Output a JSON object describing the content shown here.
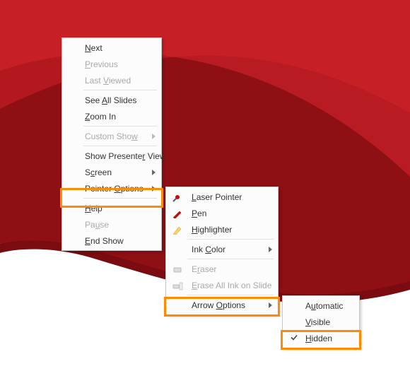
{
  "menu1": {
    "next": "Next",
    "previous": "Previous",
    "last_viewed": "Last Viewed",
    "see_all_slides": "See All Slides",
    "zoom_in": "Zoom In",
    "custom_show": "Custom Show",
    "show_presenter_view": "Show Presenter View",
    "screen": "Screen",
    "pointer_options": "Pointer Options",
    "help": "Help",
    "pause": "Pause",
    "end_show": "End Show"
  },
  "menu2": {
    "laser_pointer": "Laser Pointer",
    "pen": "Pen",
    "highlighter": "Highlighter",
    "ink_color": "Ink Color",
    "eraser": "Eraser",
    "erase_all": "Erase All Ink on Slide",
    "arrow_options": "Arrow Options"
  },
  "menu3": {
    "automatic": "Automatic",
    "visible": "Visible",
    "hidden": "Hidden"
  },
  "colors": {
    "highlight_border": "#ff8c00"
  }
}
